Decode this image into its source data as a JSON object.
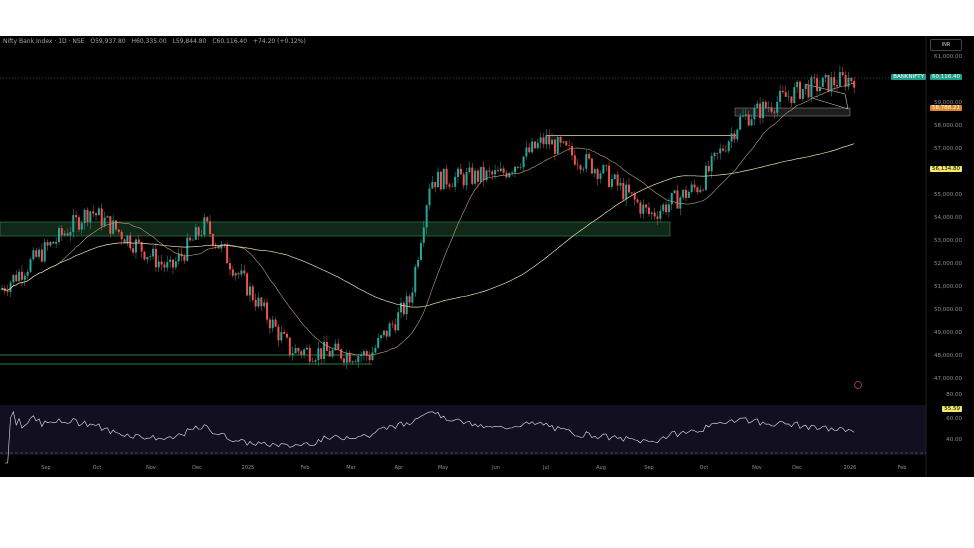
{
  "header": {
    "symbol": "Nifty Bank Index · 1D · NSE",
    "open": "O59,937.80",
    "high": "H60,335.00",
    "low": "L59,844.80",
    "close": "C60,116.40",
    "change": "+74.20 (+0.12%)",
    "currency": "INR"
  },
  "price_axis": {
    "labels": [
      "61,000.00",
      "59,000.00",
      "58,000.00",
      "57,000.00",
      "55,000.00",
      "54,000.00",
      "53,000.00",
      "52,000.00",
      "51,000.00",
      "50,000.00",
      "49,000.00",
      "48,000.00",
      "47,000.00"
    ],
    "label_values": [
      61000,
      59000,
      58000,
      57000,
      55000,
      54000,
      53000,
      52000,
      51000,
      50000,
      49000,
      48000,
      47000
    ],
    "symbol_tag": "BANKNIFTY",
    "last_price": "60,116.40",
    "ma_fast": "58,786.21",
    "ma_slow": "56,134.80"
  },
  "rsi_axis": {
    "labels": [
      "80.00",
      "60.00",
      "40.00"
    ],
    "value": "55.59"
  },
  "time_axis": [
    "Sep",
    "Oct",
    "Nov",
    "Dec",
    "2025",
    "Feb",
    "Mar",
    "Apr",
    "May",
    "Jun",
    "Jul",
    "Aug",
    "Sep",
    "Oct",
    "Nov",
    "Dec",
    "2026",
    "Feb"
  ],
  "colors": {
    "up": "#26a69a",
    "down": "#ef5350",
    "tag_green": "#1e9e8a",
    "tag_orange": "#e0872a",
    "tag_yellow": "#f3e66b",
    "ma": "#c9b98a"
  },
  "chart_data": {
    "type": "candlestick",
    "price_path": [
      50870,
      54350,
      51740,
      53700,
      48260,
      48040,
      50430,
      55650,
      55870,
      57390,
      56090,
      54130,
      55430,
      58260,
      59570,
      60116
    ]
  }
}
